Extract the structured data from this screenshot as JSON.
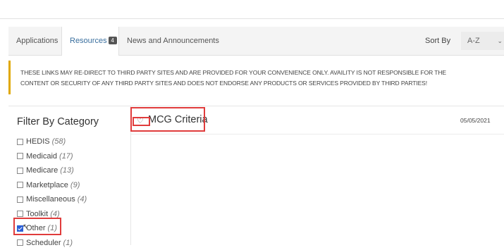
{
  "tabs": [
    {
      "label": "Applications"
    },
    {
      "label": "Resources",
      "badge": "4"
    },
    {
      "label": "News and Announcements"
    }
  ],
  "sort": {
    "label": "Sort By",
    "value": "A-Z"
  },
  "notice": {
    "line1": "THESE LINKS MAY RE-DIRECT TO THIRD PARTY SITES AND ARE PROVIDED FOR YOUR CONVENIENCE ONLY. AVAILITY IS NOT RESPONSIBLE FOR THE",
    "line2": "CONTENT OR SECURITY OF ANY THIRD PARTY SITES AND DOES NOT ENDORSE ANY PRODUCTS OR SERVICES PROVIDED BY THIRD PARTIES!"
  },
  "filter": {
    "title": "Filter By Category",
    "categories": [
      {
        "name": "HEDIS",
        "count": "(58)",
        "checked": false
      },
      {
        "name": "Medicaid",
        "count": "(17)",
        "checked": false
      },
      {
        "name": "Medicare",
        "count": "(13)",
        "checked": false
      },
      {
        "name": "Marketplace",
        "count": "(9)",
        "checked": false
      },
      {
        "name": "Miscellaneous",
        "count": "(4)",
        "checked": false
      },
      {
        "name": "Toolkit",
        "count": "(4)",
        "checked": false
      },
      {
        "name": "Other",
        "count": "(1)",
        "checked": true
      },
      {
        "name": "Scheduler",
        "count": "(1)",
        "checked": false
      }
    ]
  },
  "resource": {
    "title": "MCG Criteria",
    "date": "05/05/2021",
    "heart_icon": "heart-outline-icon"
  },
  "colors": {
    "accent": "#3a6f9e",
    "warning": "#e0a800",
    "highlight": "#e03c3c"
  }
}
